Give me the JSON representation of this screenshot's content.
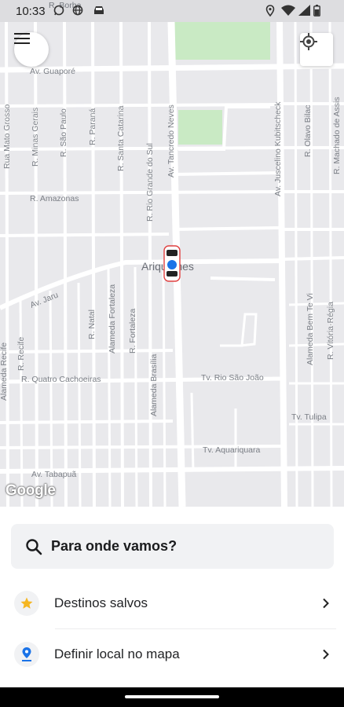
{
  "status_bar": {
    "time": "10:33",
    "icons": [
      "whatsapp-icon",
      "globe-icon",
      "car-icon",
      "location-icon",
      "wifi-icon",
      "signal-icon",
      "battery-icon"
    ]
  },
  "map": {
    "district_label": "Ariquemes",
    "streets": {
      "guapore": "Av. Guaporé",
      "borba": "R. Borba",
      "mato_grosso": "Rua Mato Grosso",
      "minas_gerais": "R. Minas Gerais",
      "sao_paulo": "R. São Paulo",
      "parana": "R. Paraná",
      "santa_catarina": "R. Santa Catarina",
      "rio_grande_do_sul": "R. Rio Grande do Sul",
      "tancredo_neves": "Av. Tancredo Neves",
      "juscelino": "Av. Juscelino Kubitscheck",
      "olavo_bilac": "R. Olavo Bilac",
      "machado_de_assis": "R. Machado de Assis",
      "amazonas": "R. Amazonas",
      "jaru": "Av. Jaru",
      "natal": "R. Natal",
      "alameda_fortaleza": "Alameda Fortaleza",
      "fortaleza": "R. Fortaleza",
      "alameda_brasilia": "Alameda Brasília",
      "bem_te_vi": "Alameda Bem Te Vi",
      "vitoria_regia": "R. Vitória-Régia",
      "recife": "R. Recife",
      "alameda_recife": "Alameda Recife",
      "quatro_cachoeiras": "R. Quatro Cachoeiras",
      "rio_sao_joao": "Tv. Rio São João",
      "tulipa": "Tv. Tulipa",
      "aquariquara": "Tv. Aquariquara",
      "tabapua": "Av. Tabapuã"
    },
    "google_logo": "Google",
    "colors": {
      "road": "#ffffff",
      "block": "#e9e9ec",
      "park": "#c9eac4",
      "user_dot": "#1a73e8"
    }
  },
  "sheet": {
    "search_label": "Para onde vamos?",
    "saved_destinations": "Destinos salvos",
    "set_on_map": "Definir local no mapa"
  }
}
